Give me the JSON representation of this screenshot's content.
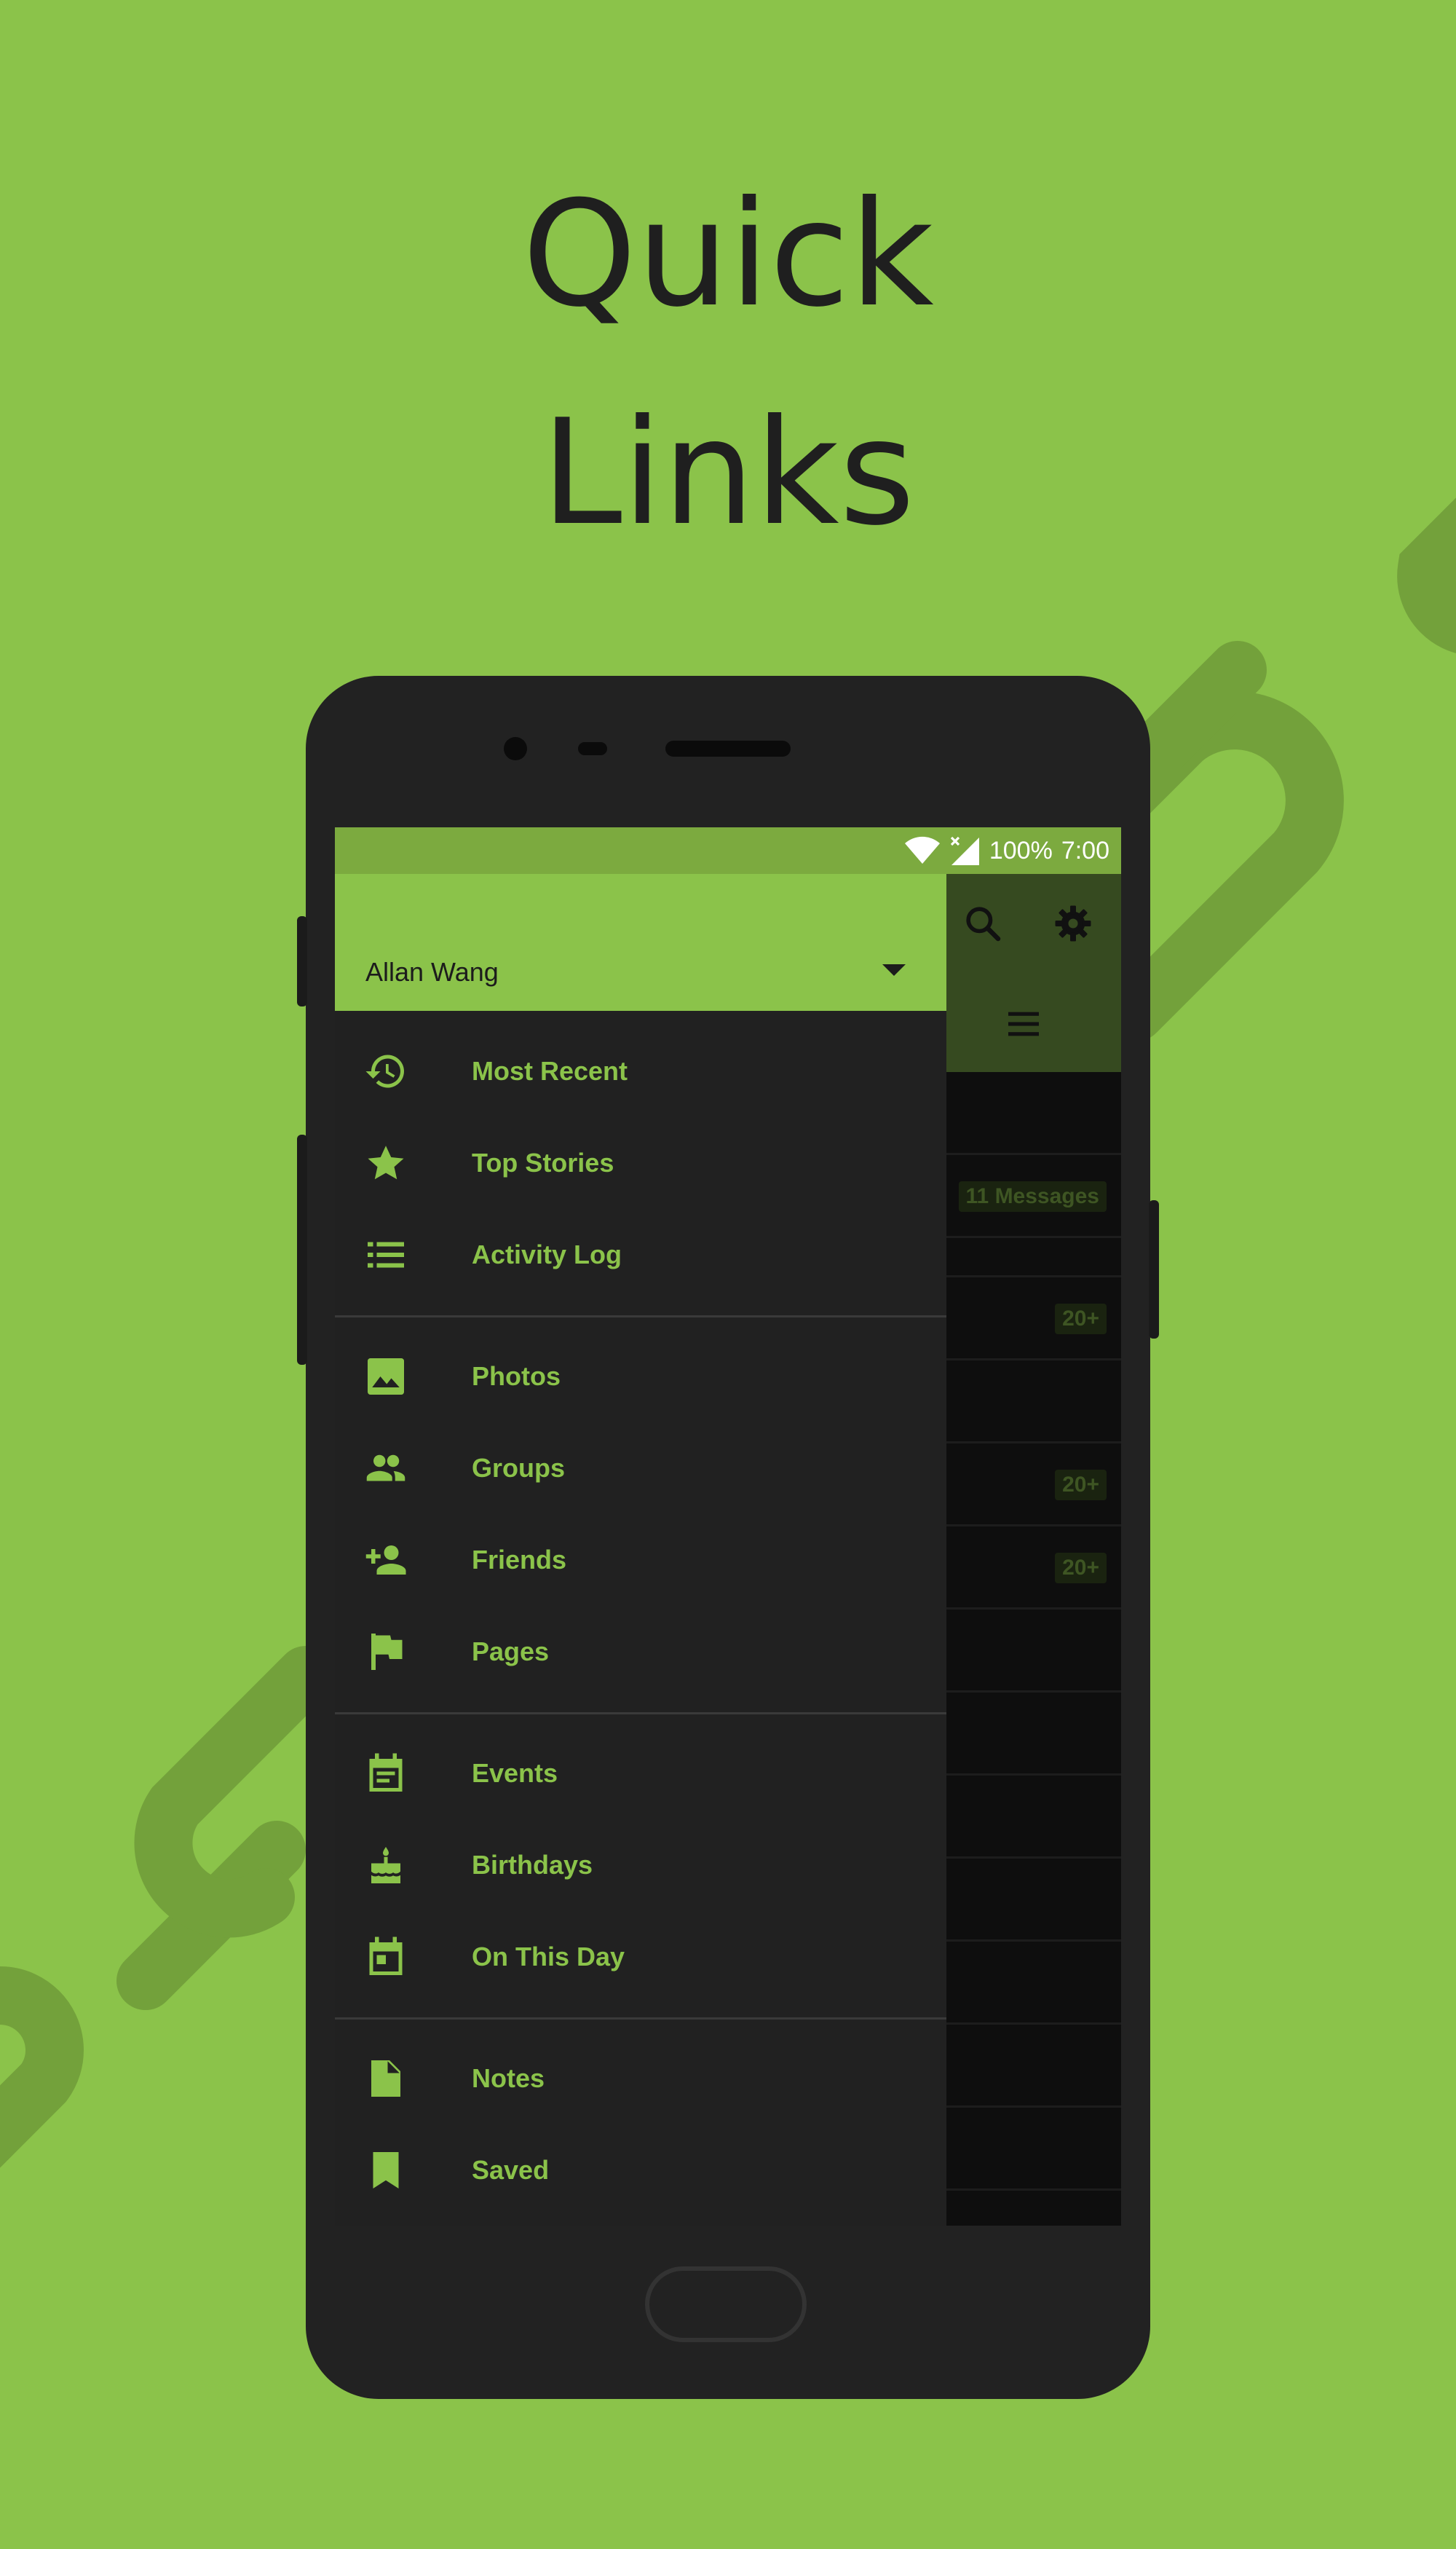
{
  "headline": {
    "line1": "Quick",
    "line2": "Links"
  },
  "status_bar": {
    "battery": "100%",
    "time": "7:00"
  },
  "background_app": {
    "badges": [
      "11 Messages",
      "20+",
      "20+",
      "20+"
    ]
  },
  "drawer": {
    "account_name": "Allan Wang",
    "sections": [
      {
        "items": [
          {
            "label": "Most Recent",
            "icon": "history-icon"
          },
          {
            "label": "Top Stories",
            "icon": "star-icon"
          },
          {
            "label": "Activity Log",
            "icon": "list-icon"
          }
        ]
      },
      {
        "items": [
          {
            "label": "Photos",
            "icon": "photo-icon"
          },
          {
            "label": "Groups",
            "icon": "groups-icon"
          },
          {
            "label": "Friends",
            "icon": "add-friend-icon"
          },
          {
            "label": "Pages",
            "icon": "flag-icon"
          }
        ]
      },
      {
        "items": [
          {
            "label": "Events",
            "icon": "event-icon"
          },
          {
            "label": "Birthdays",
            "icon": "cake-icon"
          },
          {
            "label": "On This Day",
            "icon": "calendar-day-icon"
          }
        ]
      },
      {
        "items": [
          {
            "label": "Notes",
            "icon": "note-icon"
          },
          {
            "label": "Saved",
            "icon": "bookmark-icon"
          }
        ]
      }
    ]
  },
  "colors": {
    "background": "#8bc34a",
    "accent": "#8bc34a",
    "drawer": "#212121",
    "phone_body": "#222222"
  }
}
